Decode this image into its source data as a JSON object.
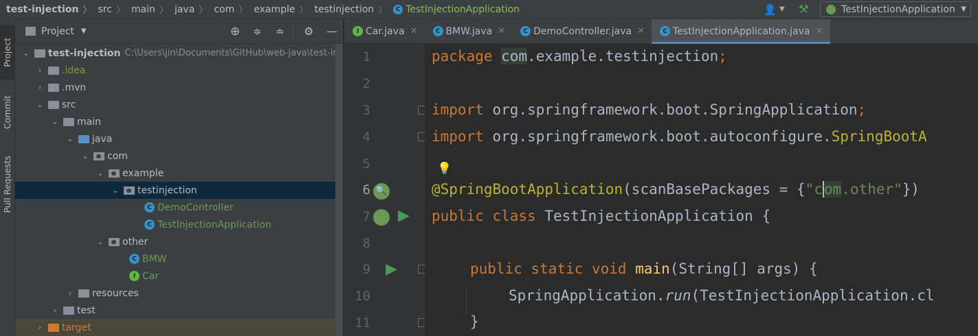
{
  "breadcrumbs": [
    "test-injection",
    "src",
    "main",
    "java",
    "com",
    "example",
    "testinjection",
    "TestInjectionApplication"
  ],
  "run_config": "TestInjectionApplication",
  "tool_strip": {
    "project": "Project",
    "commit": "Commit",
    "pull_requests": "Pull Requests"
  },
  "project_panel": {
    "title": "Project",
    "root_name": "test-injection",
    "root_path": "C:\\Users\\jin\\Documents\\GitHub\\web-java\\test-in",
    "items": [
      {
        "label": ".idea"
      },
      {
        "label": ".mvn"
      },
      {
        "label": "src"
      },
      {
        "label": "main"
      },
      {
        "label": "java"
      },
      {
        "label": "com"
      },
      {
        "label": "example"
      },
      {
        "label": "testinjection"
      },
      {
        "label": "DemoController"
      },
      {
        "label": "TestInjectionApplication"
      },
      {
        "label": "other"
      },
      {
        "label": "BMW"
      },
      {
        "label": "Car"
      },
      {
        "label": "resources"
      },
      {
        "label": "test"
      },
      {
        "label": "target"
      }
    ]
  },
  "tabs": [
    "Car.java",
    "BMW.java",
    "DemoController.java",
    "TestInjectionApplication.java"
  ],
  "editor": {
    "line_numbers": [
      "1",
      "2",
      "3",
      "4",
      "5",
      "6",
      "7",
      "8",
      "9",
      "10",
      "11"
    ],
    "code": {
      "l1_kw": "package ",
      "l1_pkg": "com",
      "l1_rest": ".example.testinjection",
      "l1_semi": ";",
      "l3_kw": "import ",
      "l3_rest": "org.springframework.boot.SpringApplication",
      "l3_semi": ";",
      "l4_kw": "import ",
      "l4_rest": "org.springframework.boot.autoconfigure.",
      "l4_cls": "SpringBootA",
      "l6_ann": "@SpringBootApplication",
      "l6_mid": "(scanBasePackages = {",
      "l6_str1": "\"c",
      "l6_str2": "om",
      "l6_str3": ".other\"",
      "l6_end": "})",
      "l7_kw": "public class ",
      "l7_rest": "TestInjectionApplication {",
      "l9_kw": "public static void ",
      "l9_fn": "main",
      "l9_rest": "(String[] args) {",
      "l10_a": "SpringApplication.",
      "l10_run": "run",
      "l10_b": "(TestInjectionApplication.cl",
      "l11": "}"
    }
  },
  "colors": {
    "keyword": "#cc7832",
    "annotation": "#bbb529",
    "string": "#6a8759",
    "function": "#ffc66d",
    "selection": "#0d293e",
    "run": "#499c54"
  }
}
